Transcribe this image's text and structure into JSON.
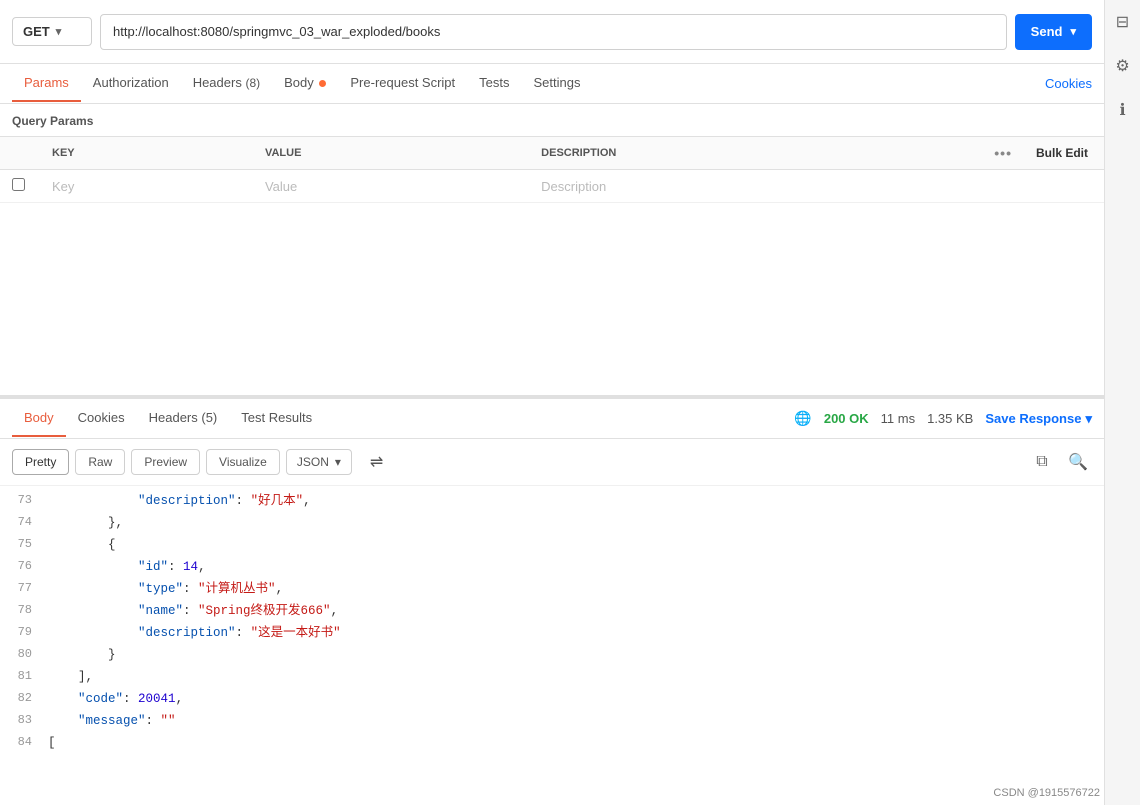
{
  "method": "GET",
  "url": "http://localhost:8080/springmvc_03_war_exploded/books",
  "send_label": "Send",
  "tabs": [
    {
      "label": "Params",
      "active": true,
      "badge": null
    },
    {
      "label": "Authorization",
      "active": false,
      "badge": null
    },
    {
      "label": "Headers",
      "active": false,
      "badge": "(8)"
    },
    {
      "label": "Body",
      "active": false,
      "dot": true
    },
    {
      "label": "Pre-request Script",
      "active": false
    },
    {
      "label": "Tests",
      "active": false
    },
    {
      "label": "Settings",
      "active": false
    }
  ],
  "cookies_link": "Cookies",
  "query_params_title": "Query Params",
  "table": {
    "headers": [
      "KEY",
      "VALUE",
      "DESCRIPTION"
    ],
    "placeholder_key": "Key",
    "placeholder_value": "Value",
    "placeholder_desc": "Description",
    "bulk_edit": "Bulk Edit"
  },
  "response": {
    "tabs": [
      {
        "label": "Body",
        "active": true
      },
      {
        "label": "Cookies",
        "active": false
      },
      {
        "label": "Headers",
        "badge": "(5)",
        "active": false
      },
      {
        "label": "Test Results",
        "active": false
      }
    ],
    "status": "200 OK",
    "time": "11 ms",
    "size": "1.35 KB",
    "save_response": "Save Response",
    "format_buttons": [
      "Pretty",
      "Raw",
      "Preview",
      "Visualize"
    ],
    "format_active": "Pretty",
    "json_format": "JSON",
    "lines": [
      {
        "num": "73",
        "content": "            \"description\": \"好几本\",",
        "type": "desc"
      },
      {
        "num": "74",
        "content": "        },",
        "type": "punct"
      },
      {
        "num": "75",
        "content": "        {",
        "type": "punct"
      },
      {
        "num": "76",
        "content": "            \"id\": 14,",
        "key": "id",
        "value": "14",
        "type": "number"
      },
      {
        "num": "77",
        "content": "            \"type\": \"计算机丛书\",",
        "key": "type",
        "value": "计算机丛书",
        "type": "string"
      },
      {
        "num": "78",
        "content": "            \"name\": \"Spring终极开发666\",",
        "key": "name",
        "value": "Spring终极开发666",
        "type": "string"
      },
      {
        "num": "79",
        "content": "            \"description\": \"这是一本好书\"",
        "key": "description",
        "value": "这是一本好书",
        "type": "string"
      },
      {
        "num": "80",
        "content": "        }",
        "type": "punct"
      },
      {
        "num": "81",
        "content": "    ],",
        "type": "punct"
      },
      {
        "num": "82",
        "content": "    \"code\": 20041,",
        "key": "code",
        "value": "20041",
        "type": "number"
      },
      {
        "num": "83",
        "content": "    \"message\": \"\"",
        "key": "message",
        "value": "",
        "type": "string"
      },
      {
        "num": "84",
        "content": "[",
        "type": "punct"
      }
    ]
  },
  "watermark": "CSDN @1915576722"
}
